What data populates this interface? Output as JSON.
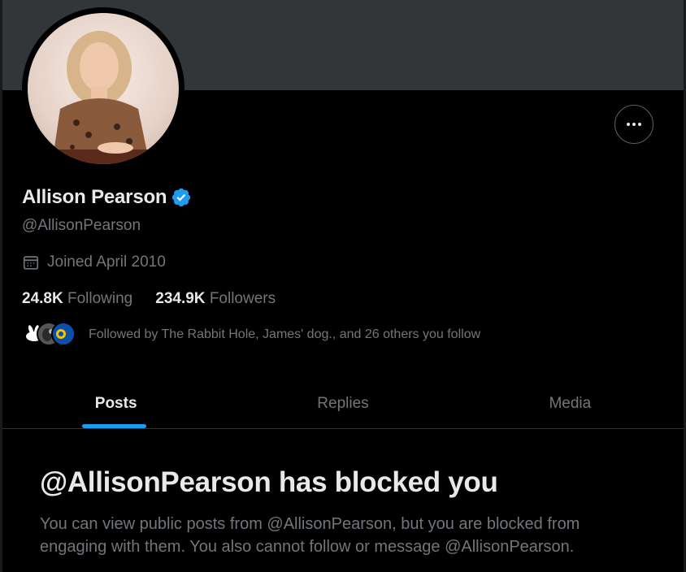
{
  "profile": {
    "name": "Allison Pearson",
    "handle": "@AllisonPearson",
    "joined": "Joined April 2010",
    "following_count": "24.8K",
    "following_label": "Following",
    "followers_count": "234.9K",
    "followers_label": "Followers",
    "followed_by": "Followed by The Rabbit Hole, James' dog., and 26 others you follow"
  },
  "tabs": [
    {
      "label": "Posts",
      "active": true
    },
    {
      "label": "Replies",
      "active": false
    },
    {
      "label": "Media",
      "active": false
    }
  ],
  "blocked": {
    "title": "@AllisonPearson has blocked you",
    "body": "You can view public posts from @AllisonPearson, but you are blocked from engaging with them. You also cannot follow or message @AllisonPearson."
  },
  "colors": {
    "background": "#000000",
    "banner": "#333639",
    "accent": "#1d9bf0",
    "primary_text": "#e7e9ea",
    "secondary_text": "#71767b",
    "border": "#2f3336"
  },
  "icons": {
    "verified": "verified-badge-icon",
    "calendar": "calendar-icon",
    "more": "more-options-icon"
  }
}
